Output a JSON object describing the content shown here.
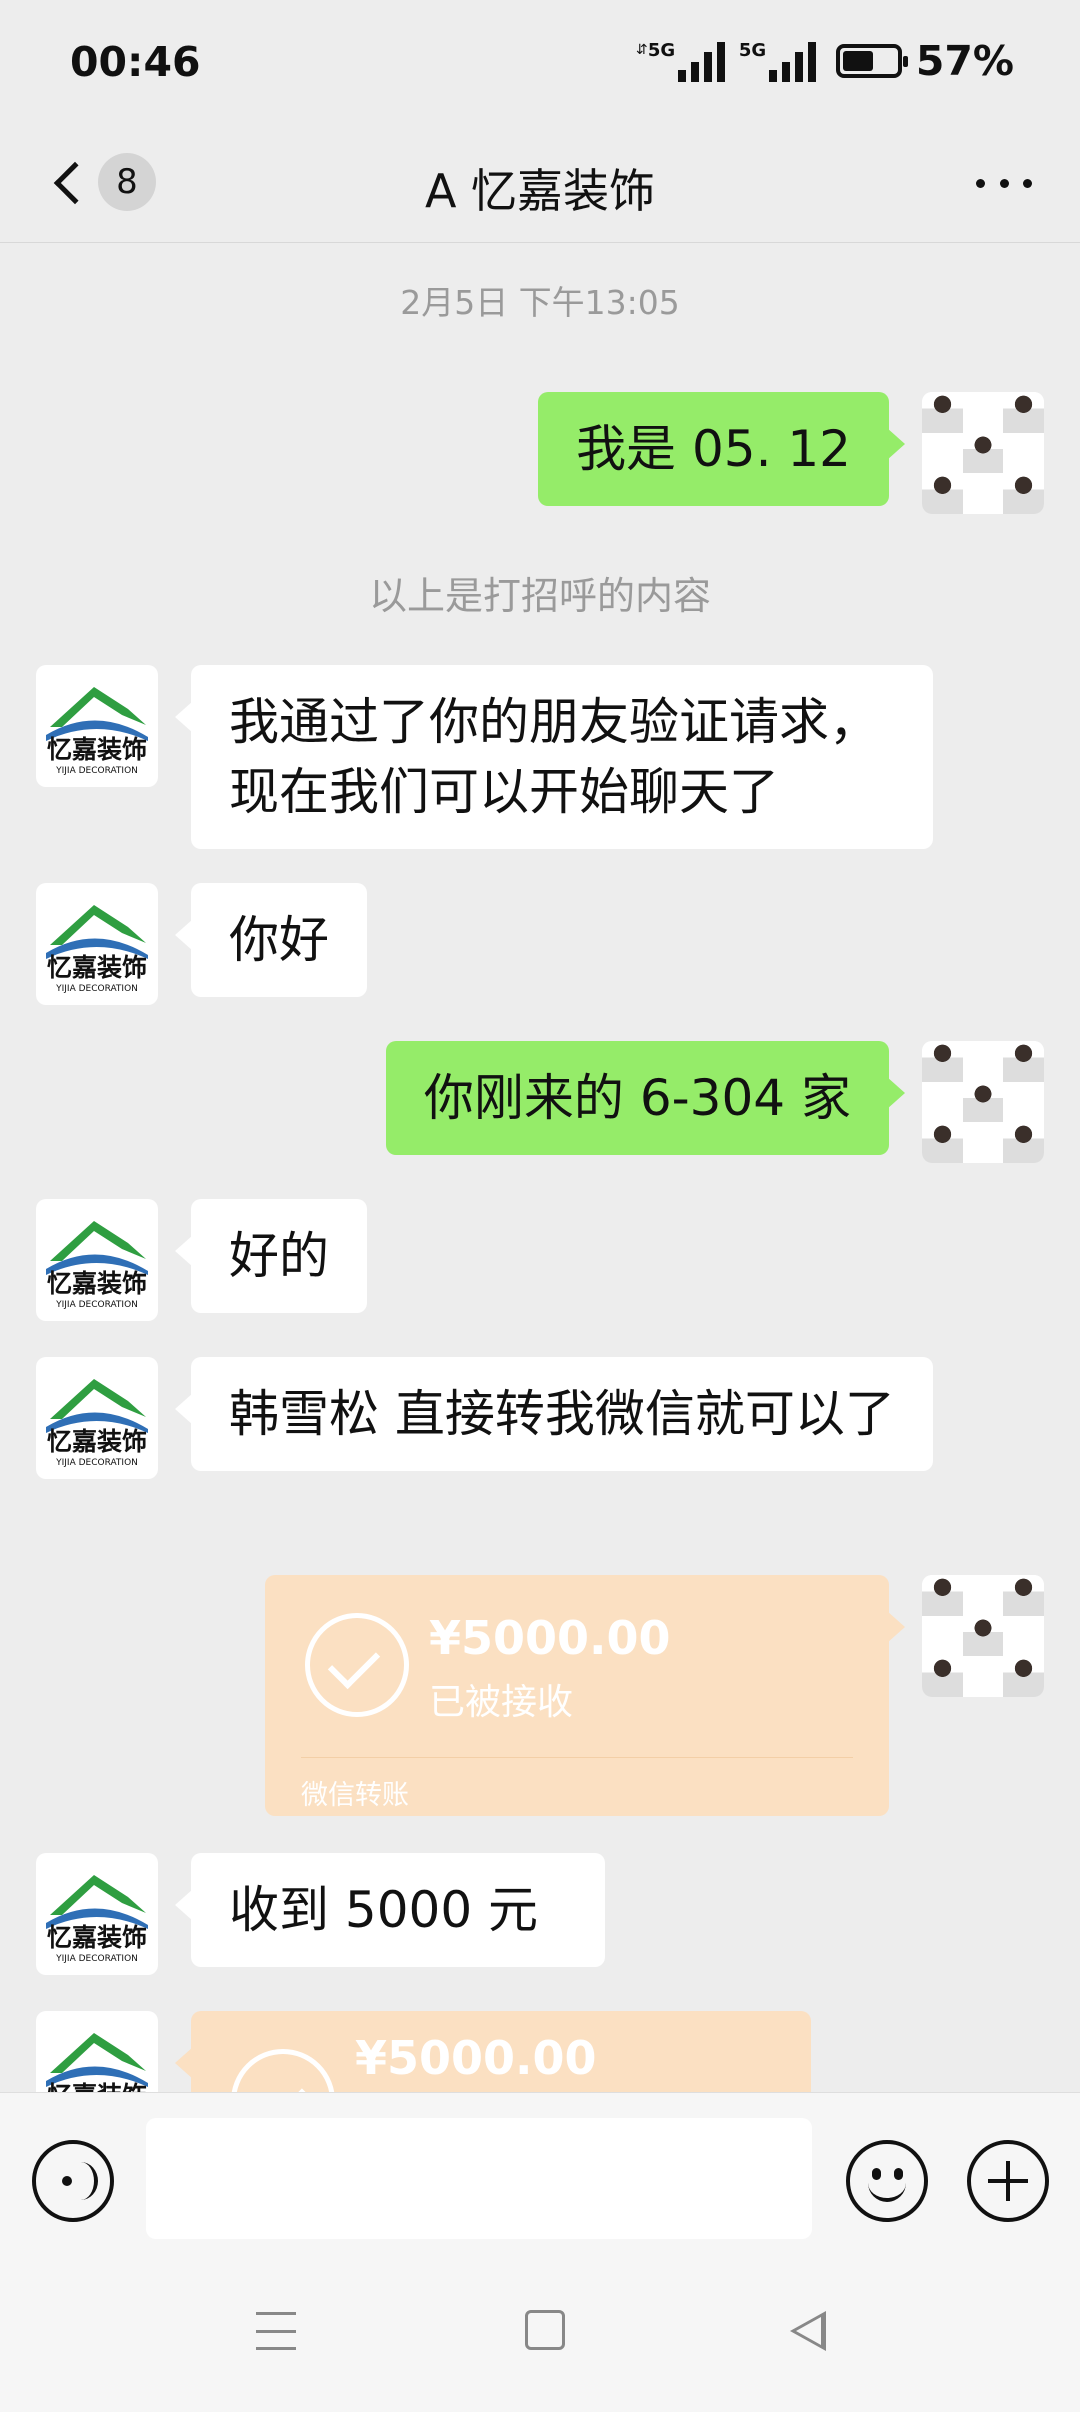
{
  "status_bar": {
    "time": "00:46",
    "signal1_label": "5G",
    "signal2_label": "5G",
    "battery_percent": "57%",
    "battery_level": 0.57
  },
  "header": {
    "unread_count": "8",
    "title": "A  忆嘉装饰"
  },
  "chat": {
    "timestamp": "2月5日 下午13:05",
    "greeting_note": "以上是打招呼的内容",
    "messages": [
      {
        "from": "me",
        "text": "我是 05. 12"
      },
      {
        "from": "them",
        "text": "我通过了你的朋友验证请求，现在我们可以开始聊天了"
      },
      {
        "from": "them",
        "text": "你好"
      },
      {
        "from": "me",
        "text": "你刚来的 6-304 家"
      },
      {
        "from": "them",
        "text": "好的"
      },
      {
        "from": "them",
        "text": "韩雪松   直接转我微信就可以了"
      },
      {
        "from": "me",
        "type": "transfer",
        "amount": "¥5000.00",
        "status": "已被接收",
        "footer": "微信转账"
      },
      {
        "from": "them",
        "text": "收到 5000 元"
      },
      {
        "from": "them",
        "type": "transfer",
        "amount": "¥5000.00"
      }
    ]
  },
  "company_avatar": {
    "logo_text": "忆嘉装饰",
    "logo_subtext": "YIJIA DECORATION"
  },
  "input_bar": {
    "voice_icon": "voice-icon",
    "emoji_icon": "emoji-icon",
    "plus_icon": "plus-icon",
    "value": ""
  },
  "colors": {
    "background": "#ededed",
    "my_bubble": "#95ec69",
    "their_bubble": "#ffffff",
    "transfer_card": "#fbe0c2"
  }
}
